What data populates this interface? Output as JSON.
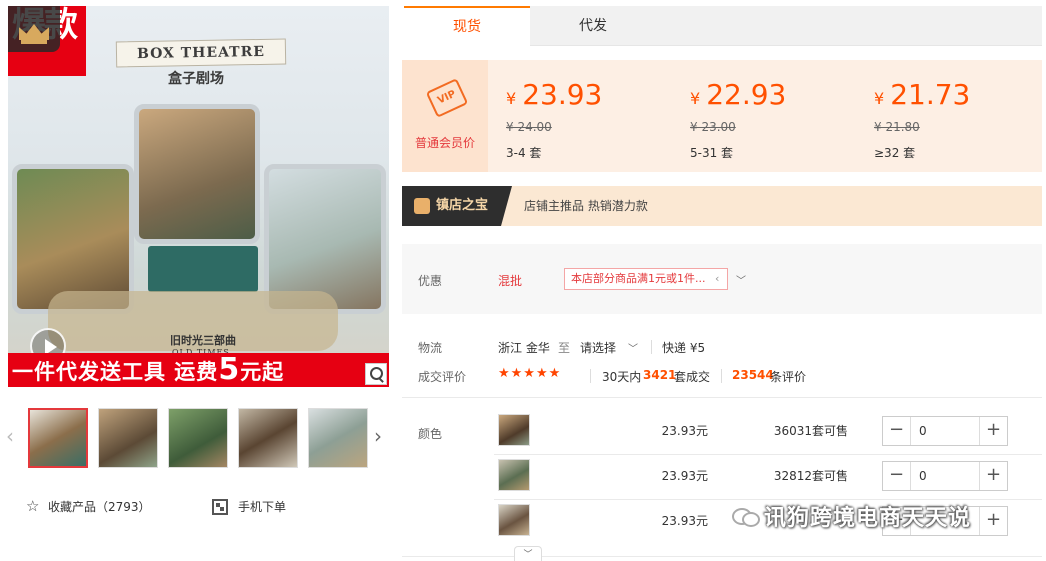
{
  "product_image": {
    "corner_tag": "爆款",
    "box_title": "BOX THEATRE",
    "sub_title": "盒子剧场",
    "series_cn": "旧时光三部曲",
    "series_en": "OLD TIMES",
    "bottom_banner_a": "一件代发送工具 运费",
    "bottom_banner_num": "5",
    "bottom_banner_b": "元起"
  },
  "gallery": {
    "thumbs": [
      "thumb-1",
      "thumb-2",
      "thumb-3",
      "thumb-4",
      "thumb-5"
    ]
  },
  "actions": {
    "favorite_label": "收藏产品（2793）",
    "mobile_order_label": "手机下单"
  },
  "tabs": [
    {
      "label": "现货",
      "active": true
    },
    {
      "label": "代发",
      "active": false
    }
  ],
  "pricing": {
    "vip_badge": "VIP",
    "vip_label": "普通会员价",
    "currency": "¥",
    "tiers": [
      {
        "price": "23.93",
        "old_price": "¥ 24.00",
        "range": "3-4 套"
      },
      {
        "price": "22.93",
        "old_price": "¥ 23.00",
        "range": "5-31 套"
      },
      {
        "price": "21.73",
        "old_price": "¥ 21.80",
        "range": "≥32 套"
      }
    ]
  },
  "shop_bar": {
    "badge": "镇店之宝",
    "text": "店铺主推品  热销潜力款"
  },
  "discount": {
    "label": "优惠",
    "type": "混批",
    "promo": "本店部分商品满1元或1件..."
  },
  "logistics": {
    "label": "物流",
    "origin": "浙江 金华",
    "to": "至",
    "dest": "请选择",
    "shipping": "快递 ¥5"
  },
  "reviews": {
    "label": "成交评价",
    "stars": "★★★★★",
    "period": "30天内",
    "sold": "3421",
    "sold_unit": "套成交",
    "review_count": "23544",
    "review_unit": "条评价"
  },
  "sku": {
    "label": "颜色",
    "rows": [
      {
        "price": "23.93元",
        "stock": "36031套可售",
        "qty": "0"
      },
      {
        "price": "23.93元",
        "stock": "32812套可售",
        "qty": "0"
      },
      {
        "price": "23.93元",
        "stock": "3",
        "qty": ""
      }
    ]
  },
  "watermark": "讯狗跨境电商天天说"
}
